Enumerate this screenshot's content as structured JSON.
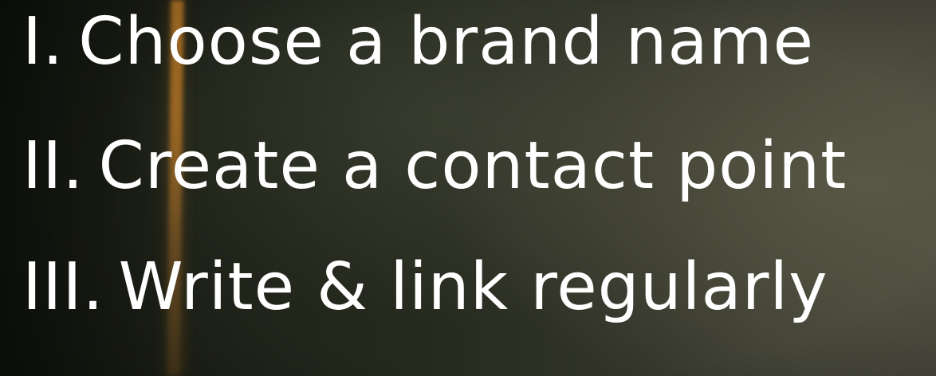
{
  "steps": [
    {
      "numeral": "I.",
      "text": "Choose a brand name"
    },
    {
      "numeral": "II.",
      "text": "Create a contact point"
    },
    {
      "numeral": "III.",
      "text": "Write & link regularly"
    }
  ]
}
